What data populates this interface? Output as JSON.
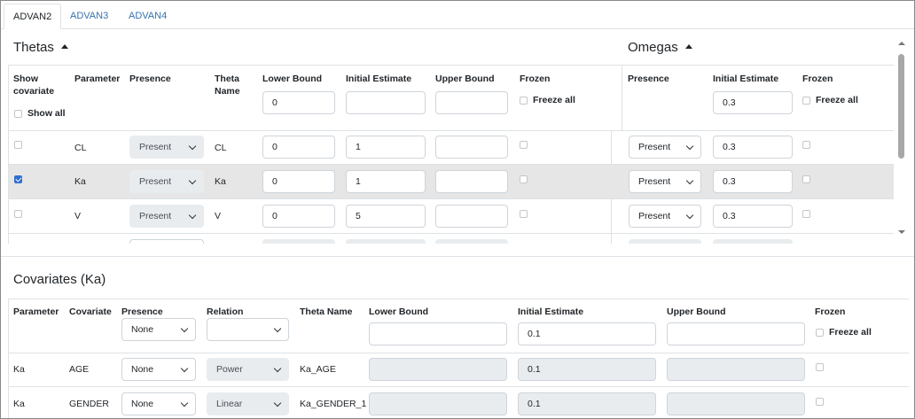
{
  "tabs": [
    {
      "label": "ADVAN2",
      "active": true
    },
    {
      "label": "ADVAN3",
      "active": false
    },
    {
      "label": "ADVAN4",
      "active": false
    }
  ],
  "thetas": {
    "title": "Thetas",
    "headers": {
      "show_covariate": "Show covariate",
      "parameter": "Parameter",
      "presence": "Presence",
      "theta_name": "Theta Name",
      "lower_bound": "Lower Bound",
      "initial_estimate": "Initial Estimate",
      "upper_bound": "Upper Bound",
      "frozen": "Frozen"
    },
    "show_all_label": "Show all",
    "freeze_all_label": "Freeze all",
    "header_lower_value": "0",
    "header_initial_value": "",
    "header_upper_value": "",
    "rows": [
      {
        "parameter": "CL",
        "presence": "Present",
        "theta_name": "CL",
        "lower": "0",
        "initial": "1",
        "upper": "",
        "show_covariate": false,
        "frozen": false
      },
      {
        "parameter": "Ka",
        "presence": "Present",
        "theta_name": "Ka",
        "lower": "0",
        "initial": "1",
        "upper": "",
        "show_covariate": true,
        "frozen": false
      },
      {
        "parameter": "V",
        "presence": "Present",
        "theta_name": "V",
        "lower": "0",
        "initial": "5",
        "upper": "",
        "show_covariate": false,
        "frozen": false
      }
    ]
  },
  "omegas": {
    "title": "Omegas",
    "headers": {
      "presence": "Presence",
      "initial_estimate": "Initial Estimate",
      "frozen": "Frozen"
    },
    "freeze_all_label": "Freeze all",
    "header_initial_value": "0.3",
    "rows": [
      {
        "presence": "Present",
        "initial": "0.3",
        "frozen": false
      },
      {
        "presence": "Present",
        "initial": "0.3",
        "frozen": false
      },
      {
        "presence": "Present",
        "initial": "0.3",
        "frozen": false
      }
    ]
  },
  "covariates": {
    "title": "Covariates (Ka)",
    "headers": {
      "parameter": "Parameter",
      "covariate": "Covariate",
      "presence": "Presence",
      "relation": "Relation",
      "theta_name": "Theta Name",
      "lower_bound": "Lower Bound",
      "initial_estimate": "Initial Estimate",
      "upper_bound": "Upper Bound",
      "frozen": "Frozen"
    },
    "header_presence_value": "None",
    "header_relation_value": "",
    "header_lower_value": "",
    "header_initial_value": "0.1",
    "header_upper_value": "",
    "freeze_all_label": "Freeze all",
    "rows": [
      {
        "parameter": "Ka",
        "covariate": "AGE",
        "presence": "None",
        "relation": "Power",
        "theta_name": "Ka_AGE",
        "lower": "",
        "initial": "0.1",
        "upper": "",
        "frozen": false
      },
      {
        "parameter": "Ka",
        "covariate": "GENDER",
        "presence": "None",
        "relation": "Linear",
        "theta_name": "Ka_GENDER_1",
        "lower": "",
        "initial": "0.1",
        "upper": "",
        "frozen": false
      }
    ]
  },
  "colors": {
    "selected_row": "#e6e6e6",
    "checkbox_checked": "#2f6fd1",
    "tab_link": "#3572b0"
  }
}
